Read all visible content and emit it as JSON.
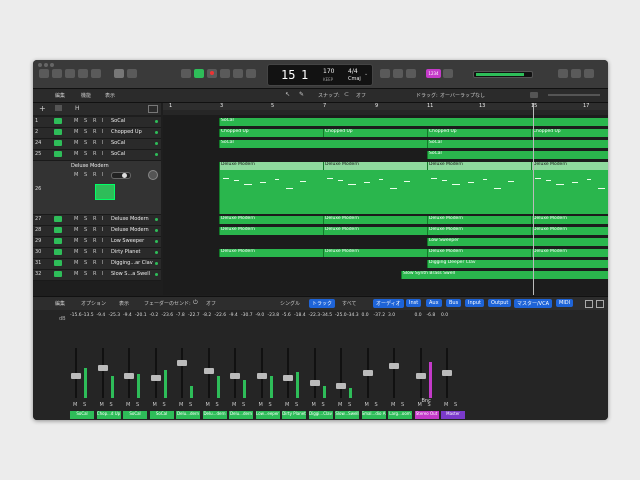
{
  "transport": {
    "bar": "15",
    "beat": "1",
    "bpm": "170",
    "bpm_label": "KEEP",
    "sig": "4/4",
    "key": "Cmaj",
    "count_badge": "1234"
  },
  "arrange_menu": {
    "edit": "編集",
    "func": "機能",
    "view": "表示",
    "snap_label": "スナップ:",
    "snap_value": "オフ",
    "drag_label": "ドラッグ:",
    "drag_value": "オーバーラップなし"
  },
  "ruler": [
    "1",
    "3",
    "5",
    "7",
    "9",
    "11",
    "13",
    "15",
    "17"
  ],
  "tracks": [
    {
      "num": "1",
      "name": "SoCal"
    },
    {
      "num": "2",
      "name": "Chopped Up"
    },
    {
      "num": "24",
      "name": "SoCal"
    },
    {
      "num": "25",
      "name": "SoCal"
    },
    {
      "num": "26",
      "name": "Deluxe Modern"
    },
    {
      "num": "27",
      "name": "Deluxe Modern"
    },
    {
      "num": "28",
      "name": "Deluxe Modern"
    },
    {
      "num": "29",
      "name": "Low Sweeper"
    },
    {
      "num": "30",
      "name": "Dirty Planet"
    },
    {
      "num": "31",
      "name": "Digging...ar Clav"
    },
    {
      "num": "32",
      "name": "Slow S...a Swell"
    }
  ],
  "msri": {
    "m": "M",
    "s": "S",
    "r": "R",
    "i": "I"
  },
  "header_h": "H",
  "regions": {
    "socal": "SoCal",
    "chopped": "Chopped Up",
    "deluxe": "Deluxe Modern",
    "low": "Low Sweeper",
    "digging": "Digging Deeper Clav",
    "slow": "Slow Synth Brass Swell"
  },
  "mixer_menu": {
    "edit": "編集",
    "options": "オプション",
    "view": "表示",
    "send_label": "フェーダーのセンド:",
    "send_value": "オフ",
    "single": "シングル",
    "tracks": "トラック",
    "all": "すべて",
    "audio": "オーディオ",
    "inst": "Inst",
    "aux": "Aux",
    "bus": "Bus",
    "input": "Input",
    "output": "Output",
    "master": "マスター/VCA",
    "midi": "MIDI"
  },
  "mixer_db_label": "dB",
  "strips": [
    {
      "name": "SoCal",
      "v1": "-15.6",
      "v2": "-13.5"
    },
    {
      "name": "Chop...d Up",
      "v1": "-9.4",
      "v2": "-25.3"
    },
    {
      "name": "SoCal",
      "v1": "-9.4",
      "v2": "-20.1"
    },
    {
      "name": "SoCal",
      "v1": "-0.2",
      "v2": "-23.6"
    },
    {
      "name": "Delu...dern",
      "v1": "-7.8",
      "v2": "-22.7"
    },
    {
      "name": "Delu...dern",
      "v1": "-8.2",
      "v2": "-22.6"
    },
    {
      "name": "Delu...dern",
      "v1": "-9.4",
      "v2": "-30.7"
    },
    {
      "name": "Low...eeper",
      "v1": "-9.0",
      "v2": "-23.8"
    },
    {
      "name": "Dirty Planet",
      "v1": "-5.6",
      "v2": "-18.4"
    },
    {
      "name": "Diggi...Clav",
      "v1": "-22.3",
      "v2": "-34.5"
    },
    {
      "name": "Slow...Swell",
      "v1": "-25.0",
      "v2": "-34.3"
    },
    {
      "name": "Smal...dio A",
      "v1": "0.0",
      "v2": "-37.2"
    },
    {
      "name": "Larg...oom",
      "v1": "3.0",
      "v2": ""
    },
    {
      "name": "Stereo Out",
      "v1": "0.0",
      "v2": "-6.8"
    },
    {
      "name": "Master",
      "v1": "0.0",
      "v2": ""
    }
  ],
  "bnc": "Bnc",
  "colors": {
    "track_green": "#2ebd59",
    "stereo_out": "#c43ac9",
    "master": "#7a3acb",
    "accent_blue": "#1e64d8"
  }
}
